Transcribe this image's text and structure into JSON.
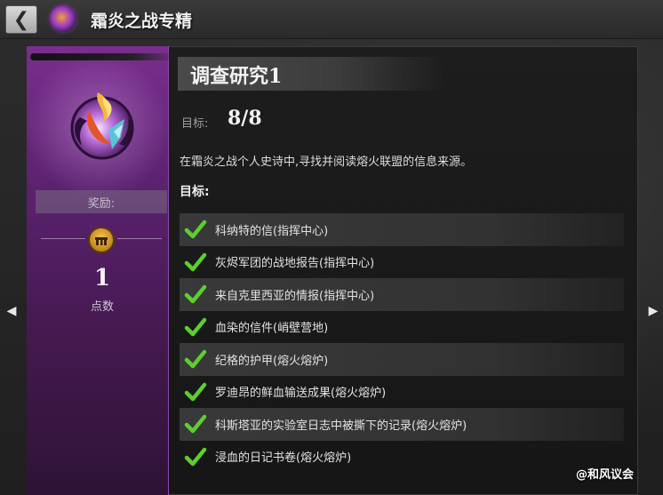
{
  "header": {
    "back_icon": "chevron-left-icon",
    "emblem_icon": "frost-flame-emblem-icon",
    "title": "霜炎之战专精"
  },
  "nav": {
    "prev_icon": "triangle-left-icon",
    "next_icon": "triangle-right-icon"
  },
  "reward": {
    "emblem_icon": "frost-flame-crest-icon",
    "label": "奖励:",
    "medal_icon": "mastery-point-icon",
    "points": "1",
    "points_label": "点数"
  },
  "achievement": {
    "title": "调查研究1",
    "goal_label": "目标:",
    "goal_value": "8/8",
    "description": "在霜炎之战个人史诗中,寻找并阅读熔火联盟的信息来源。",
    "objectives_title": "目标:",
    "objectives": [
      {
        "label": "科纳特的信(指挥中心)",
        "done": true
      },
      {
        "label": "灰烬军团的战地报告(指挥中心)",
        "done": true
      },
      {
        "label": "来自克里西亚的情报(指挥中心)",
        "done": true
      },
      {
        "label": "血染的信件(峭壁营地)",
        "done": true
      },
      {
        "label": "纪格的护甲(熔火熔炉)",
        "done": true
      },
      {
        "label": "罗迪昂的鲜血输送成果(熔火熔炉)",
        "done": true
      },
      {
        "label": "科斯塔亚的实验室日志中被撕下的记录(熔火熔炉)",
        "done": true
      },
      {
        "label": "浸血的日记书卷(熔火熔炉)",
        "done": true
      }
    ]
  },
  "watermark": "@和风议会",
  "colors": {
    "check": "#5ccf2e",
    "accent_purple": "#7a2e8e",
    "medal": "#d59a2a"
  }
}
